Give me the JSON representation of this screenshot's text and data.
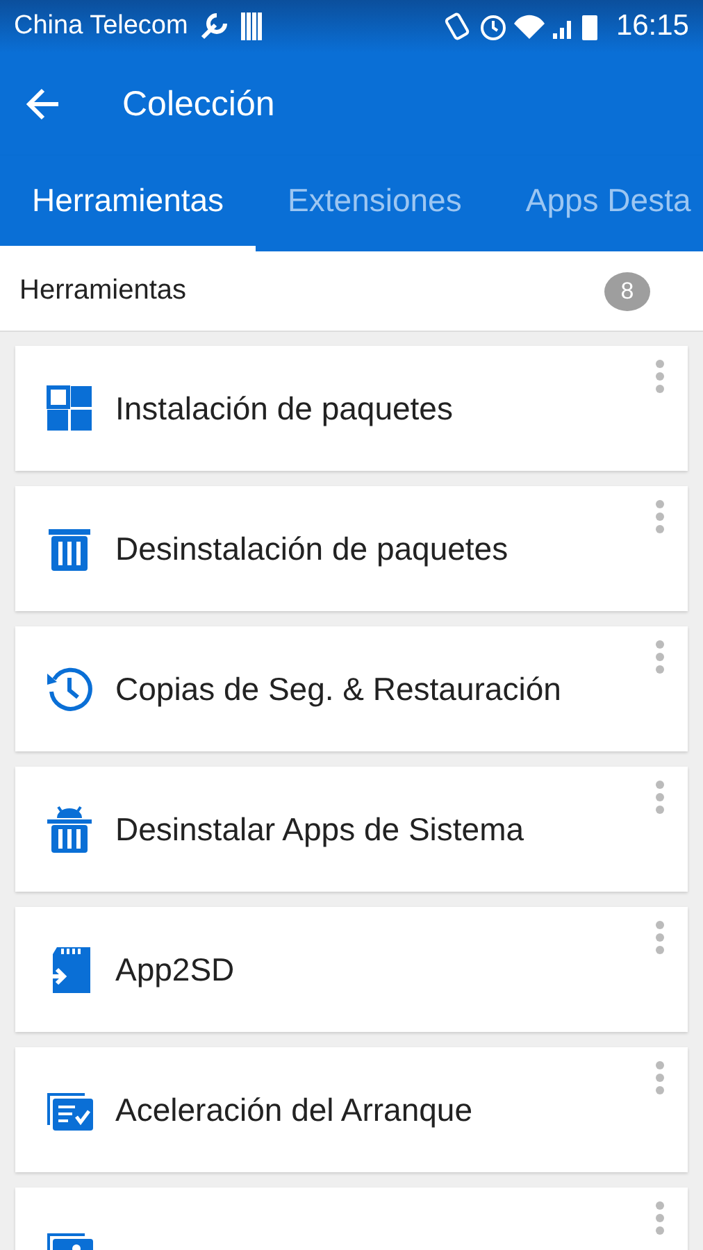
{
  "status_bar": {
    "carrier": "China Telecom",
    "time": "16:15"
  },
  "toolbar": {
    "title": "Colección"
  },
  "tabs": [
    {
      "label": "Herramientas",
      "selected": true
    },
    {
      "label": "Extensiones",
      "selected": false
    },
    {
      "label": "Apps Desta",
      "selected": false
    }
  ],
  "section": {
    "title": "Herramientas",
    "count": "8"
  },
  "items": [
    {
      "kind": "grid",
      "label": "Instalación de paquetes"
    },
    {
      "kind": "trash",
      "label": "Desinstalación de paquetes"
    },
    {
      "kind": "history",
      "label": "Copias de Seg. & Restauración"
    },
    {
      "kind": "android-trash",
      "label": "Desinstalar Apps de Sistema"
    },
    {
      "kind": "sdcard",
      "label": "App2SD"
    },
    {
      "kind": "checklist",
      "label": "Aceleración del Arranque"
    },
    {
      "kind": "image"
    }
  ]
}
